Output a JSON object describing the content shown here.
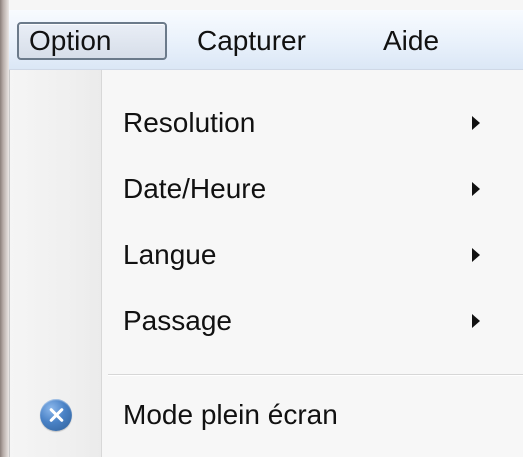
{
  "menubar": {
    "items": [
      {
        "label": "Option"
      },
      {
        "label": "Capturer"
      },
      {
        "label": "Aide"
      }
    ]
  },
  "dropdown": {
    "items": [
      {
        "label": "Resolution",
        "submenu": true
      },
      {
        "label": "Date/Heure",
        "submenu": true
      },
      {
        "label": "Langue",
        "submenu": true
      },
      {
        "label": "Passage",
        "submenu": true
      },
      {
        "label": "Mode plein écran",
        "icon": "fullscreen-x-icon",
        "submenu": false
      }
    ]
  },
  "colors": {
    "menubar_top": "#f8fbff",
    "menubar_bottom": "#dbe7f6",
    "selected_border": "#6b7a8a",
    "menu_background": "#f7f7f7",
    "icon_blue": "#4a82c6"
  }
}
